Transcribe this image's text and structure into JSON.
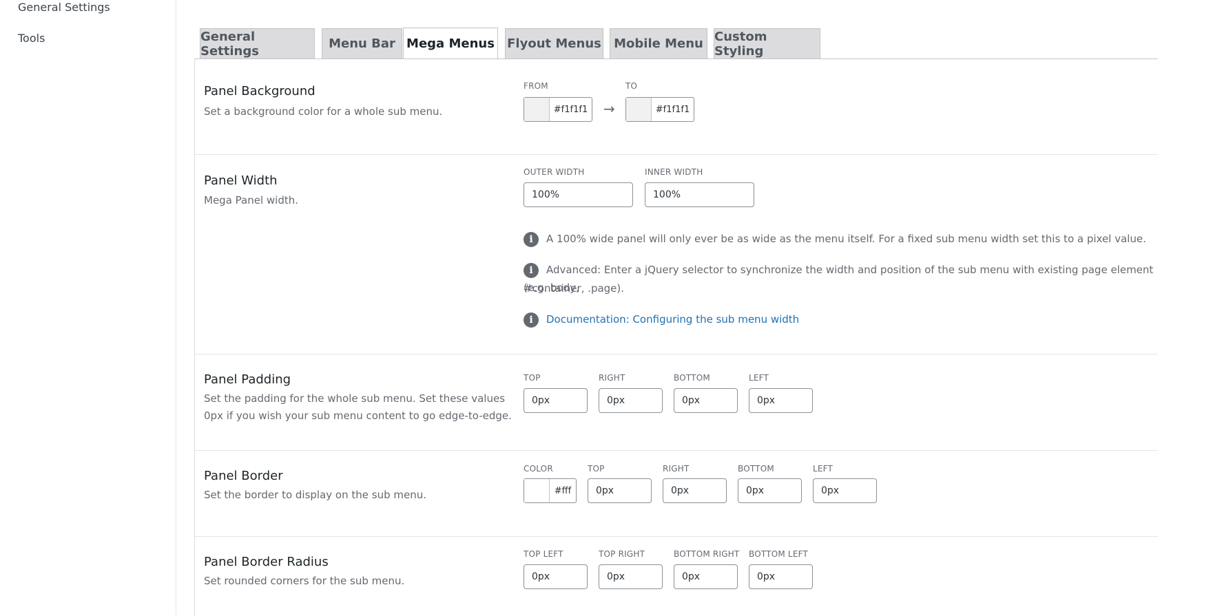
{
  "sidebar": {
    "items": [
      {
        "label": "General Settings"
      },
      {
        "label": "Tools"
      }
    ]
  },
  "tabs": [
    {
      "label": "General Settings",
      "active": false
    },
    {
      "label": "Menu Bar",
      "active": false
    },
    {
      "label": "Mega Menus",
      "active": true
    },
    {
      "label": "Flyout Menus",
      "active": false
    },
    {
      "label": "Mobile Menu",
      "active": false
    },
    {
      "label": "Custom Styling",
      "active": false
    }
  ],
  "panel_background": {
    "title": "Panel Background",
    "description": "Set a background color for a whole sub menu.",
    "from_label": "FROM",
    "to_label": "TO",
    "from_value": "#f1f1f1",
    "to_value": "#f1f1f1",
    "arrow": "→"
  },
  "panel_width": {
    "title": "Panel Width",
    "description": "Mega Panel width.",
    "outer_label": "OUTER WIDTH",
    "inner_label": "INNER WIDTH",
    "outer_value": "100%",
    "inner_value": "100%",
    "note1": "A 100% wide panel will only ever be as wide as the menu itself. For a fixed sub menu width set this to a pixel value.",
    "note2_line1": "Advanced: Enter a jQuery selector to synchronize the width and position of the sub menu with existing page element (e.g. body,",
    "note2_line2": "#container, .page).",
    "note3_link": "Documentation: Configuring the sub menu width"
  },
  "panel_padding": {
    "title": "Panel Padding",
    "description_line1": "Set the padding for the whole sub menu. Set these values",
    "description_line2": "0px if you wish your sub menu content to go edge-to-edge.",
    "labels": [
      "TOP",
      "RIGHT",
      "BOTTOM",
      "LEFT"
    ],
    "values": [
      "0px",
      "0px",
      "0px",
      "0px"
    ]
  },
  "panel_border": {
    "title": "Panel Border",
    "description": "Set the border to display on the sub menu.",
    "color_label": "COLOR",
    "color_value": "#fff",
    "labels": [
      "TOP",
      "RIGHT",
      "BOTTOM",
      "LEFT"
    ],
    "values": [
      "0px",
      "0px",
      "0px",
      "0px"
    ]
  },
  "panel_border_radius": {
    "title": "Panel Border Radius",
    "description": "Set rounded corners for the sub menu.",
    "labels": [
      "TOP LEFT",
      "TOP RIGHT",
      "BOTTOM RIGHT",
      "BOTTOM LEFT"
    ],
    "values": [
      "0px",
      "0px",
      "0px",
      "0px"
    ]
  },
  "icons": {
    "info": "i"
  },
  "colors": {
    "swatch_bg": "#f1f1f1",
    "border_swatch": "#ffffff",
    "link": "#2271b1"
  }
}
